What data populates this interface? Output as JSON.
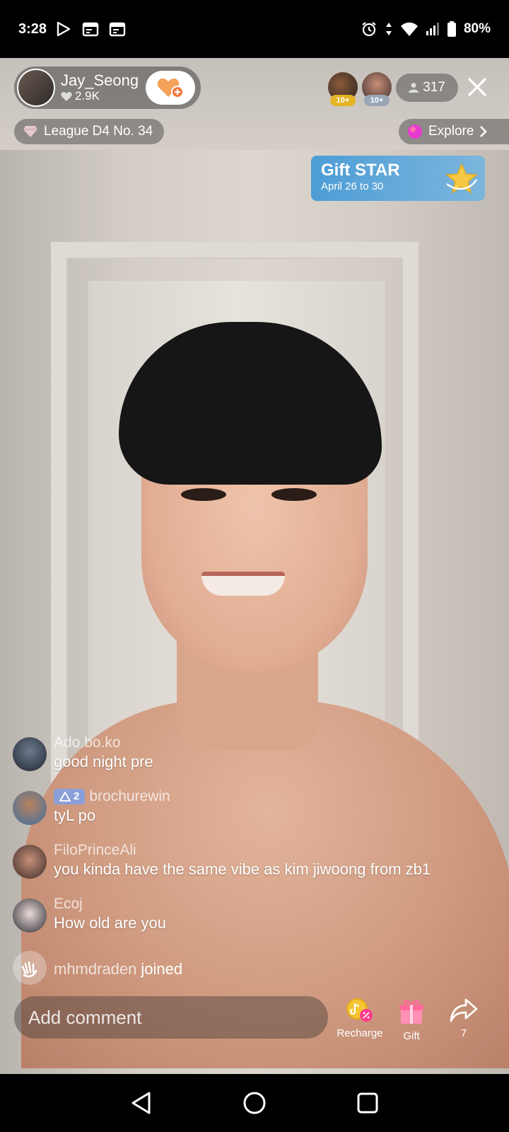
{
  "status_bar": {
    "time": "3:28",
    "battery": "80%"
  },
  "host": {
    "name": "Jay_Seong",
    "likes": "2.9K"
  },
  "viewers": {
    "badge_1": "10+",
    "badge_2": "10+",
    "count": "317"
  },
  "league": {
    "label": "League D4 No. 34"
  },
  "explore": {
    "label": "Explore"
  },
  "gift_star": {
    "title": "Gift STAR",
    "date": "April 26 to 30"
  },
  "comments": [
    {
      "user": "Ado.bo.ko",
      "text": "good night pre"
    },
    {
      "user": "brochurewin",
      "level": "2",
      "text": "tyL po"
    },
    {
      "user": "FiloPrinceAli",
      "text": "you kinda have the same vibe as kim jiwoong from zb1"
    },
    {
      "user": "Ecoj",
      "text": "How old are you"
    }
  ],
  "joined": {
    "user": "mhmdraden",
    "text": "joined"
  },
  "bottom": {
    "comment_placeholder": "Add comment",
    "recharge_label": "Recharge",
    "gift_label": "Gift",
    "share_count": "7"
  },
  "colors": {
    "follow_heart": "#f5a15a",
    "gift_star_bg": "#5aa4d8",
    "level_badge": "#8a9fd8",
    "explore_icon": "#e83bd1"
  }
}
